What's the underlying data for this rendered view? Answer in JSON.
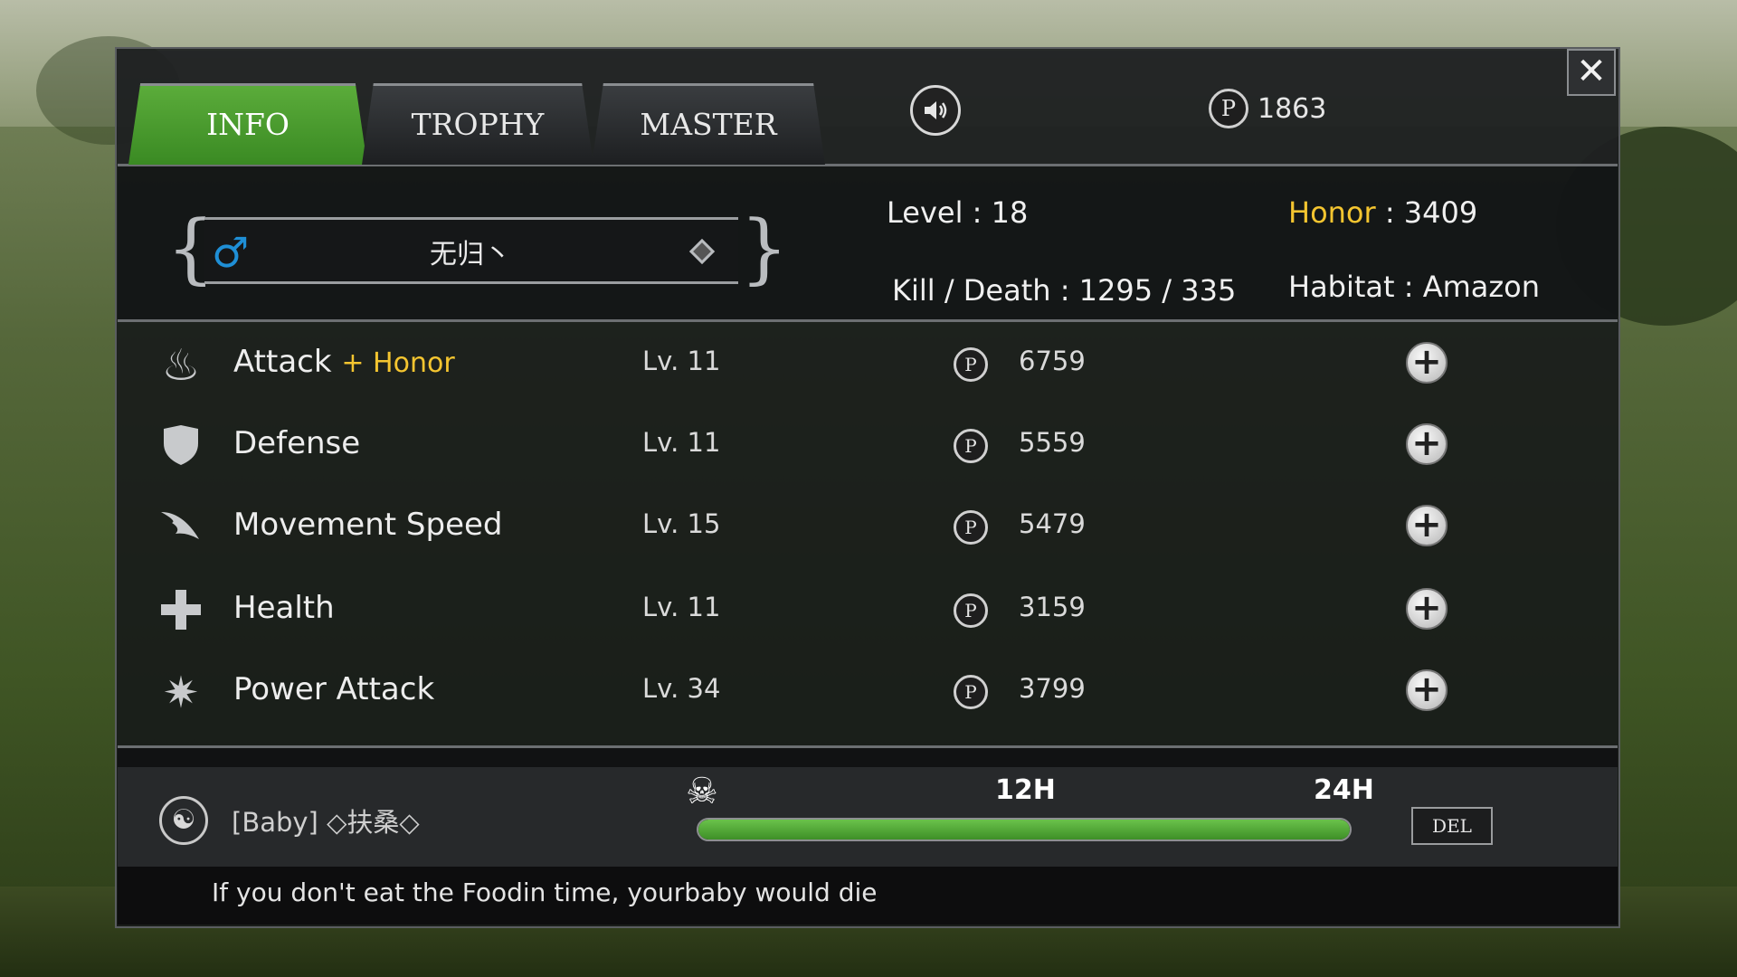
{
  "tabs": [
    {
      "label": "INFO",
      "active": true
    },
    {
      "label": "TROPHY",
      "active": false
    },
    {
      "label": "MASTER",
      "active": false
    }
  ],
  "points": "1863",
  "character": {
    "gender_icon": "male-symbol-icon",
    "name": "无归丶",
    "level_label": "Level",
    "level_sep": ":",
    "level": "18",
    "honor_label": "Honor",
    "honor_sep": ":",
    "honor": "3409",
    "kd_label": "Kill / Death",
    "kd_sep": ":",
    "kd": "1295 / 335",
    "habitat_label": "Habitat",
    "habitat_sep": ":",
    "habitat": "Amazon"
  },
  "stats": [
    {
      "icon": "flame-claw-icon",
      "name": "Attack",
      "bonus": "+ Honor",
      "level": "Lv. 11",
      "cost": "6759"
    },
    {
      "icon": "shield-icon",
      "name": "Defense",
      "bonus": "",
      "level": "Lv. 11",
      "cost": "5559"
    },
    {
      "icon": "wing-icon",
      "name": "Movement Speed",
      "bonus": "",
      "level": "Lv. 15",
      "cost": "5479"
    },
    {
      "icon": "health-cross-icon",
      "name": "Health",
      "bonus": "",
      "level": "Lv. 11",
      "cost": "3159"
    },
    {
      "icon": "burst-star-icon",
      "name": "Power Attack",
      "bonus": "",
      "level": "Lv. 34",
      "cost": "3799"
    }
  ],
  "coin_letter": "P",
  "baby": {
    "name": "[Baby] ◇扶桑◇",
    "hour_12": "12H",
    "hour_24": "24H",
    "food_fraction": 1.0,
    "delete_label": "DEL"
  },
  "warning": "If you don't eat the Foodin time, yourbaby would die",
  "colors": {
    "active_tab": "#4a9c2f",
    "honor": "#f4c530",
    "male": "#1f8fd6",
    "food_bar": "#56b13a"
  }
}
